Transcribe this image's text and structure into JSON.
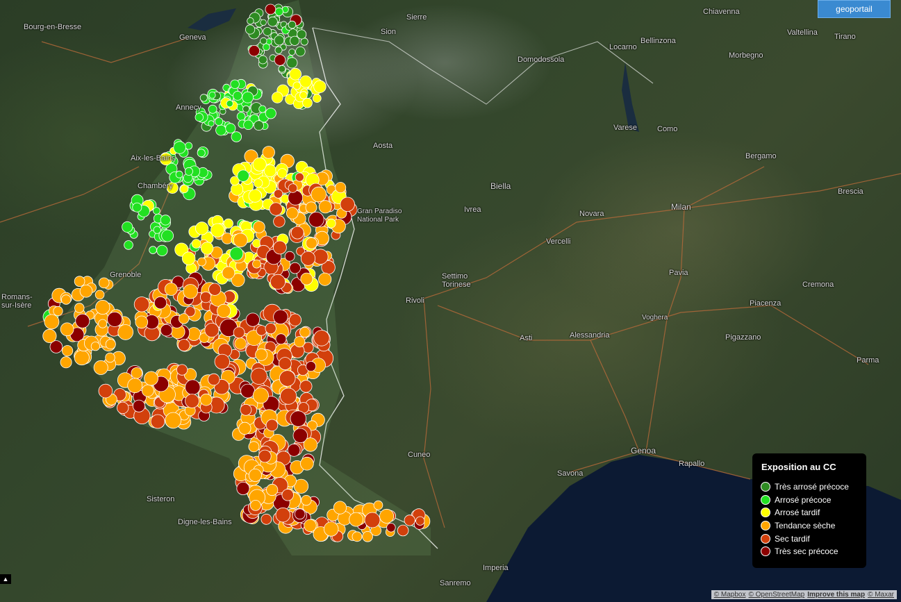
{
  "button": {
    "label": "geoportail"
  },
  "legend": {
    "title": "Exposition au CC",
    "items": [
      {
        "label": "Très arrosé précoce",
        "color": "#2e8b22"
      },
      {
        "label": "Arrosé précoce",
        "color": "#22e022"
      },
      {
        "label": "Arrosé tardif",
        "color": "#ffff00"
      },
      {
        "label": "Tendance sèche",
        "color": "#ffa500"
      },
      {
        "label": "Sec tardif",
        "color": "#d2400c"
      },
      {
        "label": "Très sec précoce",
        "color": "#8b0000"
      }
    ]
  },
  "places": [
    {
      "name": "Bourg-en-Bresse"
    },
    {
      "name": "Geneva"
    },
    {
      "name": "Annecy"
    },
    {
      "name": "Aix-les-Bains"
    },
    {
      "name": "Chambéry"
    },
    {
      "name": "Grenoble"
    },
    {
      "name": "Romans-sur-Isère"
    },
    {
      "name": "Sisteron"
    },
    {
      "name": "Digne-les-Bains"
    },
    {
      "name": "Sierre"
    },
    {
      "name": "Sion"
    },
    {
      "name": "Domodossola"
    },
    {
      "name": "Locarno"
    },
    {
      "name": "Bellinzona"
    },
    {
      "name": "Chiavenna"
    },
    {
      "name": "Valtellina"
    },
    {
      "name": "Tirano"
    },
    {
      "name": "Morbegno"
    },
    {
      "name": "Varese"
    },
    {
      "name": "Como"
    },
    {
      "name": "Aosta"
    },
    {
      "name": "Biella"
    },
    {
      "name": "Bergamo"
    },
    {
      "name": "Brescia"
    },
    {
      "name": "Gran Paradiso National Park"
    },
    {
      "name": "Ivrea"
    },
    {
      "name": "Novara"
    },
    {
      "name": "Milan"
    },
    {
      "name": "Vercelli"
    },
    {
      "name": "Settimo Torinese"
    },
    {
      "name": "Rivoli"
    },
    {
      "name": "Pavia"
    },
    {
      "name": "Cremona"
    },
    {
      "name": "Piacenza"
    },
    {
      "name": "Voghera"
    },
    {
      "name": "Asti"
    },
    {
      "name": "Alessandria"
    },
    {
      "name": "Pigazzano"
    },
    {
      "name": "Parma"
    },
    {
      "name": "Cuneo"
    },
    {
      "name": "Genoa"
    },
    {
      "name": "Savona"
    },
    {
      "name": "Rapallo"
    },
    {
      "name": "Imperia"
    },
    {
      "name": "Sanremo"
    }
  ],
  "attribution": {
    "mapbox": "© Mapbox",
    "osm": "© OpenStreetMap",
    "improve": "Improve this map",
    "maxar": "© Maxar"
  }
}
